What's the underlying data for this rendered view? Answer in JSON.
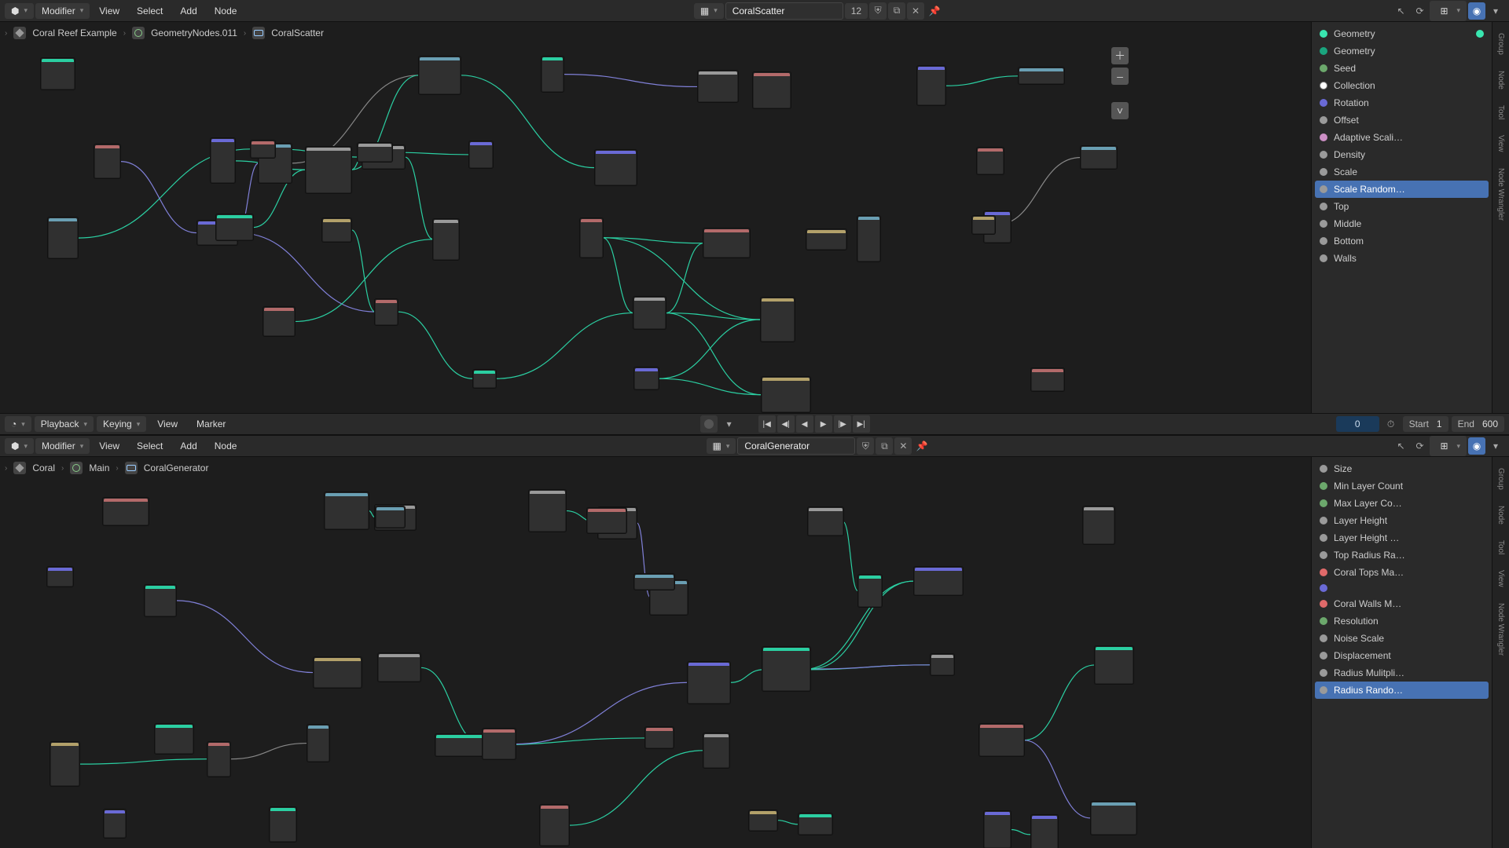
{
  "top1": {
    "mode": "Modifier",
    "menus": [
      "View",
      "Select",
      "Add",
      "Node"
    ],
    "tree_name": "CoralScatter",
    "users": "12",
    "right_tools": [
      "arrow",
      "refresh",
      "snap",
      "globe"
    ]
  },
  "breadcrumb1": [
    {
      "icon": "obj",
      "label": "Coral Reef Example"
    },
    {
      "icon": "grp",
      "label": "GeometryNodes.011"
    },
    {
      "icon": "ng",
      "label": "CoralScatter",
      "badge": "12"
    }
  ],
  "side1": {
    "cats": [
      "Group",
      "Node",
      "Tool",
      "View",
      "Node Wrangler"
    ],
    "header": {
      "label": "Geometry",
      "type": "geo"
    },
    "items": [
      {
        "label": "Geometry",
        "type": "geo-out"
      },
      {
        "label": "Seed",
        "type": "int"
      },
      {
        "label": "Collection",
        "type": "col"
      },
      {
        "label": "Rotation",
        "type": "vec"
      },
      {
        "label": "Offset",
        "type": "flt"
      },
      {
        "label": "Adaptive Scali…",
        "type": "bool"
      },
      {
        "label": "Density",
        "type": "flt"
      },
      {
        "label": "Scale",
        "type": "flt"
      },
      {
        "label": "Scale Random…",
        "type": "flt",
        "selected": true
      },
      {
        "label": "Top",
        "type": "flt"
      },
      {
        "label": "Middle",
        "type": "flt"
      },
      {
        "label": "Bottom",
        "type": "flt"
      },
      {
        "label": "Walls",
        "type": "flt"
      }
    ]
  },
  "timeline": {
    "menus_left": [
      "Playback",
      "Keying"
    ],
    "menus_plain": [
      "View",
      "Marker"
    ],
    "frame": "0",
    "start_label": "Start",
    "start": "1",
    "end_label": "End",
    "end": "600"
  },
  "top2": {
    "mode": "Modifier",
    "menus": [
      "View",
      "Select",
      "Add",
      "Node"
    ],
    "tree_name": "CoralGenerator"
  },
  "breadcrumb2": [
    {
      "icon": "obj",
      "label": "Coral"
    },
    {
      "icon": "grp",
      "label": "Main"
    },
    {
      "icon": "ng",
      "label": "CoralGenerator"
    }
  ],
  "side2": {
    "cats": [
      "Group",
      "Node",
      "Tool",
      "View",
      "Node Wrangler"
    ],
    "items": [
      {
        "label": "Size",
        "type": "flt"
      },
      {
        "label": "Min Layer Count",
        "type": "int"
      },
      {
        "label": "Max Layer Co…",
        "type": "int"
      },
      {
        "label": "Layer Height",
        "type": "flt"
      },
      {
        "label": "Layer Height …",
        "type": "flt"
      },
      {
        "label": "Top Radius Ra…",
        "type": "flt"
      },
      {
        "label": "Coral Tops Ma…",
        "type": "mat"
      },
      {
        "label": "",
        "type": "vec"
      },
      {
        "label": "Coral Walls M…",
        "type": "mat"
      },
      {
        "label": "Resolution",
        "type": "int"
      },
      {
        "label": "Noise Scale",
        "type": "flt"
      },
      {
        "label": "Displacement",
        "type": "flt"
      },
      {
        "label": "Radius Mulitpli…",
        "type": "flt"
      },
      {
        "label": "Radius Rando…",
        "type": "flt",
        "selected": true
      }
    ]
  },
  "icons": {
    "shield": "⛨",
    "copy": "⧉",
    "close": "✕",
    "pin": "📌",
    "plus": "＋",
    "minus": "–",
    "chev": "˅",
    "first": "⏮",
    "prev_key": "⏪",
    "prev": "◀",
    "play": "▶",
    "next": "⏩",
    "next_key": "⏭",
    "last": "⏭",
    "clock": "⏱"
  }
}
